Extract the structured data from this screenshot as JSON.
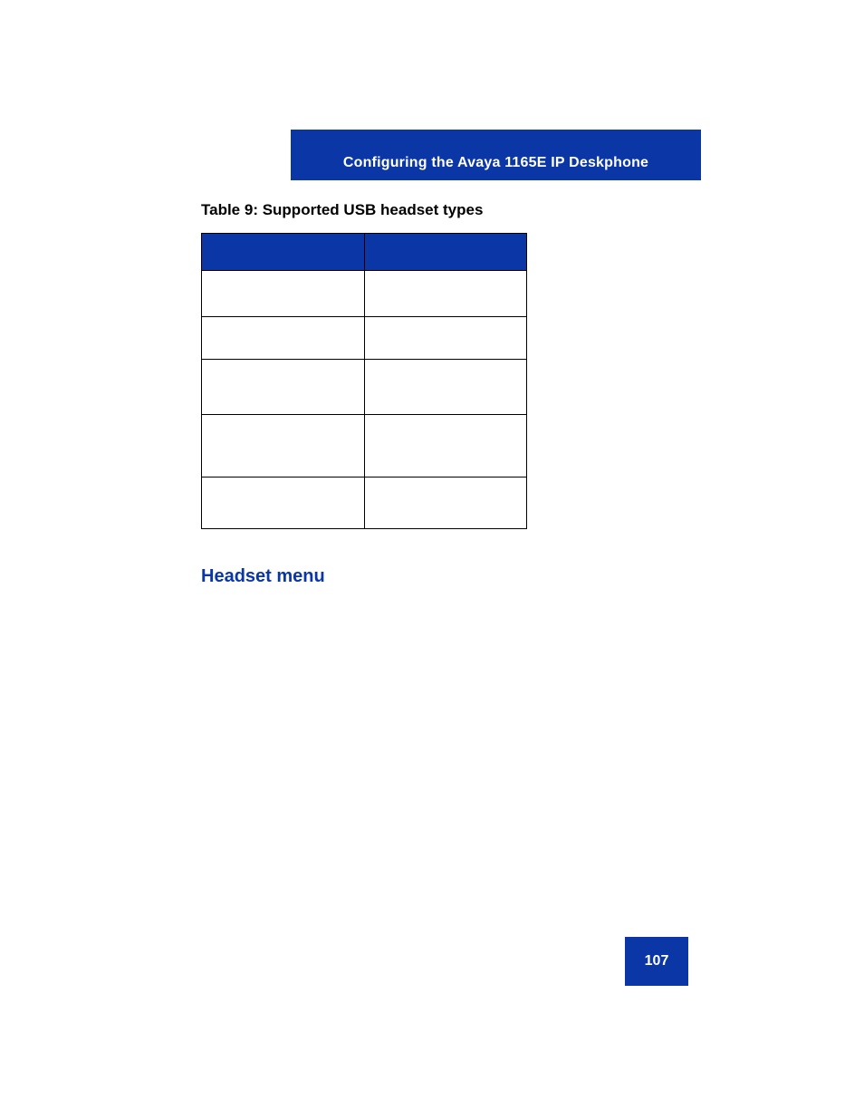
{
  "header": {
    "section_title": "Configuring the Avaya 1165E IP Deskphone"
  },
  "table": {
    "caption": "Table 9: Supported USB headset types",
    "headers": [
      "",
      ""
    ],
    "rows": [
      [
        "",
        ""
      ],
      [
        "",
        ""
      ],
      [
        "",
        ""
      ],
      [
        "",
        ""
      ],
      [
        "",
        ""
      ]
    ]
  },
  "section": {
    "heading": "Headset menu"
  },
  "footer": {
    "page_number": "107"
  }
}
